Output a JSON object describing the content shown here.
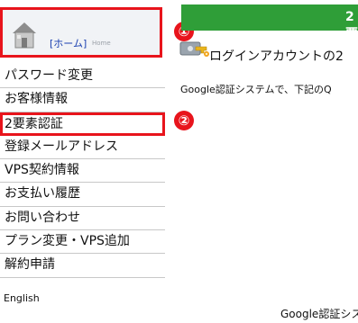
{
  "home": {
    "link_label": "[ホーム]",
    "sub_label": "Home"
  },
  "nav": {
    "items": [
      {
        "label": "パスワード変更"
      },
      {
        "label": "お客様情報"
      },
      {
        "label": "2要素認証"
      },
      {
        "label": "登録メールアドレス"
      },
      {
        "label": "VPS契約情報"
      },
      {
        "label": "お支払い履歴"
      },
      {
        "label": "お問い合わせ"
      },
      {
        "label": "プラン変更・VPS追加"
      },
      {
        "label": "解約申請"
      }
    ],
    "language": "English"
  },
  "callouts": {
    "one": "①",
    "two": "②"
  },
  "header": {
    "title_fragment": "2要"
  },
  "content": {
    "login_title": "ログインアカウントの2",
    "description": "Google認証システムで、下記のQ",
    "bottom_text": "Google認証シス"
  },
  "colors": {
    "accent_red": "#e8141c",
    "header_green": "#2f9e38",
    "link_blue": "#1a3fb0"
  },
  "icons": [
    "home-icon",
    "key-icon"
  ]
}
